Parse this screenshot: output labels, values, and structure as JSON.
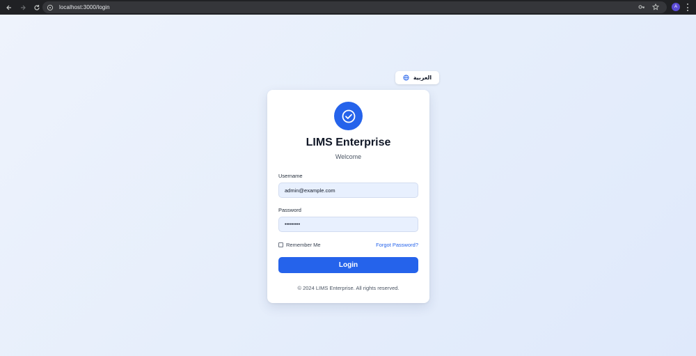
{
  "browser": {
    "url": "localhost:3000/login",
    "avatar_initial": "A"
  },
  "language_toggle": {
    "label": "العربية"
  },
  "card": {
    "title": "LIMS Enterprise",
    "subtitle": "Welcome",
    "username": {
      "label": "Username",
      "value": "admin@example.com"
    },
    "password": {
      "label": "Password",
      "value": "•••••••••"
    },
    "remember_label": "Remember Me",
    "forgot_label": "Forgot Password?",
    "login_label": "Login",
    "footer": "© 2024 LIMS Enterprise. All rights reserved."
  },
  "colors": {
    "accent": "#2563eb",
    "page_bg": "#e9f0fb",
    "chrome_bg": "#202124"
  }
}
